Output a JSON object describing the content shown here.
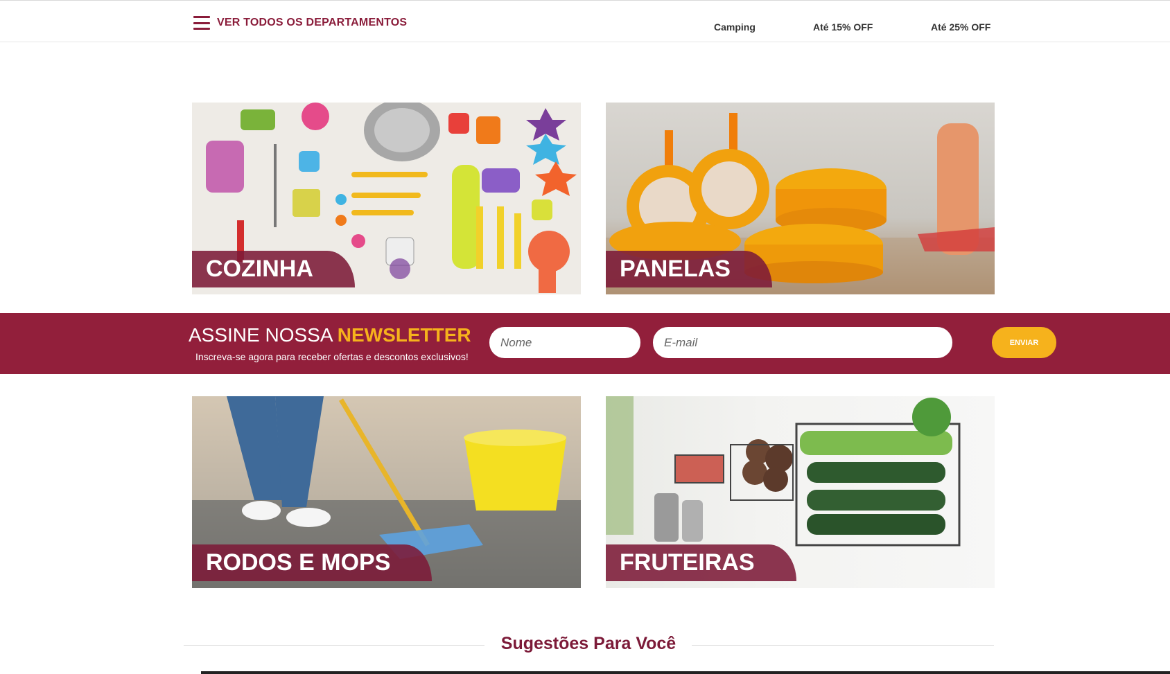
{
  "header": {
    "departments_label": "VER TODOS OS DEPARTAMENTOS",
    "nav": [
      "Camping",
      "Até 15% OFF",
      "Até 25% OFF"
    ]
  },
  "categories": [
    {
      "label": "COZINHA"
    },
    {
      "label": "PANELAS"
    },
    {
      "label": "RODOS E MOPS"
    },
    {
      "label": "FRUTEIRAS"
    }
  ],
  "newsletter": {
    "title_prefix": "ASSINE NOSSA",
    "title_highlight": "NEWSLETTER",
    "subtitle": "Inscreva-se agora para receber ofertas e descontos exclusivos!",
    "name_placeholder": "Nome",
    "email_placeholder": "E-mail",
    "button": "ENVIAR"
  },
  "suggestions": {
    "title": "Sugestões Para Você"
  },
  "colors": {
    "brand": "#921f3b",
    "accent": "#f6b21c"
  }
}
